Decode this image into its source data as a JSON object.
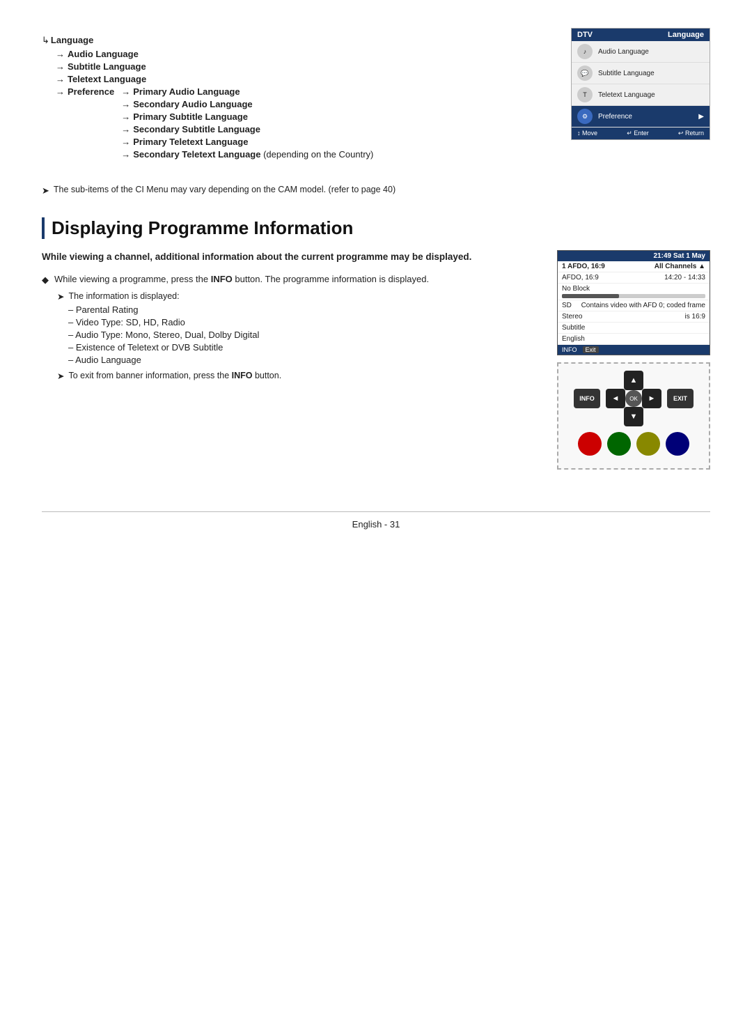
{
  "top_section": {
    "tree": {
      "root_label": "Language",
      "level1": [
        {
          "label": "Audio Language",
          "bold": true
        },
        {
          "label": "Subtitle Language",
          "bold": true
        },
        {
          "label": "Teletext Language",
          "bold": true
        },
        {
          "label": "Preference",
          "bold": true,
          "children": [
            "Primary Audio Language",
            "Secondary Audio Language",
            "Primary Subtitle Language",
            "Secondary Subtitle Language",
            "Primary Teletext Language",
            "Secondary Teletext Language (depending on the Country)"
          ]
        }
      ]
    },
    "tv_menu": {
      "header_left": "DTV",
      "header_right": "Language",
      "rows": [
        {
          "label": "Audio Language",
          "icon": "♪",
          "selected": false
        },
        {
          "label": "Subtitle Language",
          "icon": "💬",
          "selected": false
        },
        {
          "label": "Teletext Language",
          "icon": "T",
          "selected": false
        },
        {
          "label": "Preference",
          "icon": "⚙",
          "selected": true,
          "has_arrow": true
        }
      ],
      "footer": {
        "move": "↕ Move",
        "enter": "↵ Enter",
        "return": "↩ Return"
      }
    }
  },
  "note1": "The sub-items of the CI Menu may vary depending on the CAM model. (refer to page 40)",
  "section": {
    "title": "Displaying Programme Information",
    "intro": "While viewing a channel, additional information about the current programme may be displayed.",
    "bullet1_text": "While viewing a programme, press the ",
    "bullet1_bold": "INFO",
    "bullet1_rest": " button. The programme information is displayed.",
    "sub_note": "The information is displayed:",
    "list_items": [
      "Parental Rating",
      "Video Type: SD, HD, Radio",
      "Audio Type: Mono, Stereo, Dual, Dolby Digital",
      "Existence of Teletext or DVB Subtitle",
      "Audio Language"
    ],
    "note2_text": "To exit from banner information, press the ",
    "note2_bold": "INFO",
    "note2_rest": " button."
  },
  "tv_info": {
    "header_time": "21:49 Sat 1 May",
    "row1_left": "1 AFDO, 16:9",
    "row1_right": "All Channels ▲",
    "row2_left": "AFDO, 16:9",
    "row2_right": "14:20 - 14:33",
    "row3_left": "No Block",
    "row4_left": "SD",
    "row4_right": "Contains video with AFD 0; coded frame",
    "row5_left": "Stereo",
    "row5_right": "is 16:9",
    "row6_left": "Subtitle",
    "row7_left": "English",
    "footer_info": "INFO",
    "footer_exit": "Exit"
  },
  "remote": {
    "info_label": "INFO",
    "exit_label": "EXIT",
    "nav_up": "▲",
    "nav_down": "▼",
    "nav_left": "◄",
    "nav_right": "►",
    "nav_center": "OK"
  },
  "footer": {
    "text": "English - 31"
  }
}
